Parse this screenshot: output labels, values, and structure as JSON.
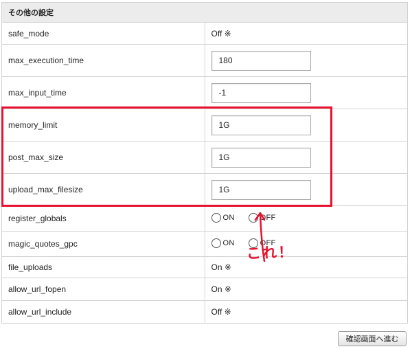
{
  "section_title": "その他の設定",
  "rows": [
    {
      "key": "safe_mode",
      "type": "text",
      "value": "Off ※"
    },
    {
      "key": "max_execution_time",
      "type": "input",
      "value": "180"
    },
    {
      "key": "max_input_time",
      "type": "input",
      "value": "-1"
    },
    {
      "key": "memory_limit",
      "type": "input",
      "value": "1G"
    },
    {
      "key": "post_max_size",
      "type": "input",
      "value": "1G"
    },
    {
      "key": "upload_max_filesize",
      "type": "input",
      "value": "1G"
    },
    {
      "key": "register_globals",
      "type": "radio",
      "on_label": "ON",
      "off_label": "OFF",
      "selected": "OFF"
    },
    {
      "key": "magic_quotes_gpc",
      "type": "radio",
      "on_label": "ON",
      "off_label": "OFF",
      "selected": "OFF"
    },
    {
      "key": "file_uploads",
      "type": "text",
      "value": "On ※"
    },
    {
      "key": "allow_url_fopen",
      "type": "text",
      "value": "On ※"
    },
    {
      "key": "allow_url_include",
      "type": "text",
      "value": "Off ※"
    }
  ],
  "submit_label": "確認画面へ進む",
  "annotation": {
    "text": "これ！",
    "color": "#e8112d"
  }
}
